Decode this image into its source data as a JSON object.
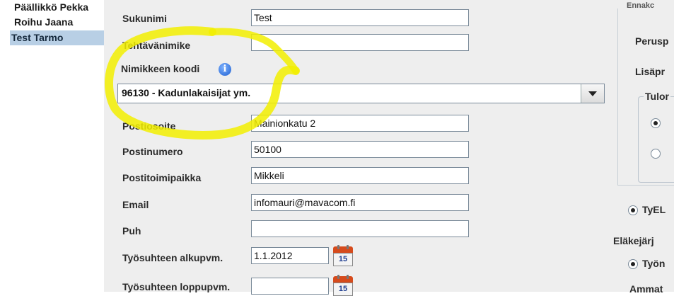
{
  "employee_list": {
    "items": [
      {
        "name": "Päällikkö Pekka",
        "selected": false
      },
      {
        "name": "Roihu Jaana",
        "selected": false
      },
      {
        "name": "Test Tarmo",
        "selected": true
      }
    ]
  },
  "form": {
    "sukunimi": {
      "label": "Sukunimi",
      "value": "Test"
    },
    "tehtavanimike": {
      "label": "Tehtävänimike",
      "value": ""
    },
    "nimikkeen_koodi": {
      "label": "Nimikkeen koodi",
      "info_icon": "info-icon",
      "selected": "96130 - Kadunlakaisijat ym."
    },
    "postiosoite": {
      "label": "Postiosoite",
      "value": "Mainionkatu 2"
    },
    "postinumero": {
      "label": "Postinumero",
      "value": "50100"
    },
    "postitoimipaikka": {
      "label": "Postitoimipaikka",
      "value": "Mikkeli"
    },
    "email": {
      "label": "Email",
      "value": "infomauri@mavacom.fi"
    },
    "puh": {
      "label": "Puh",
      "value": ""
    },
    "alkupvm": {
      "label": "Työsuhteen alkupvm.",
      "value": "1.1.2012",
      "calendar_day": "15"
    },
    "loppupvm": {
      "label": "Työsuhteen loppupvm.",
      "value": "",
      "calendar_day": "15"
    }
  },
  "right_panel": {
    "top_label": "Ennakc",
    "perus_label": "Perusp",
    "lisa_label": "Lisäpr",
    "group_title": "Tulor",
    "radio_a_label": "",
    "radio_b_label": "",
    "tyel_label": "TyEL",
    "elake_label": "Eläkejärj",
    "tyon_label": "Työn",
    "ammat_label": "Ammat"
  },
  "colors": {
    "selection": "#b8cfe5",
    "highlight_stroke": "#f2ee00",
    "panel_bg": "#eeeeee"
  }
}
